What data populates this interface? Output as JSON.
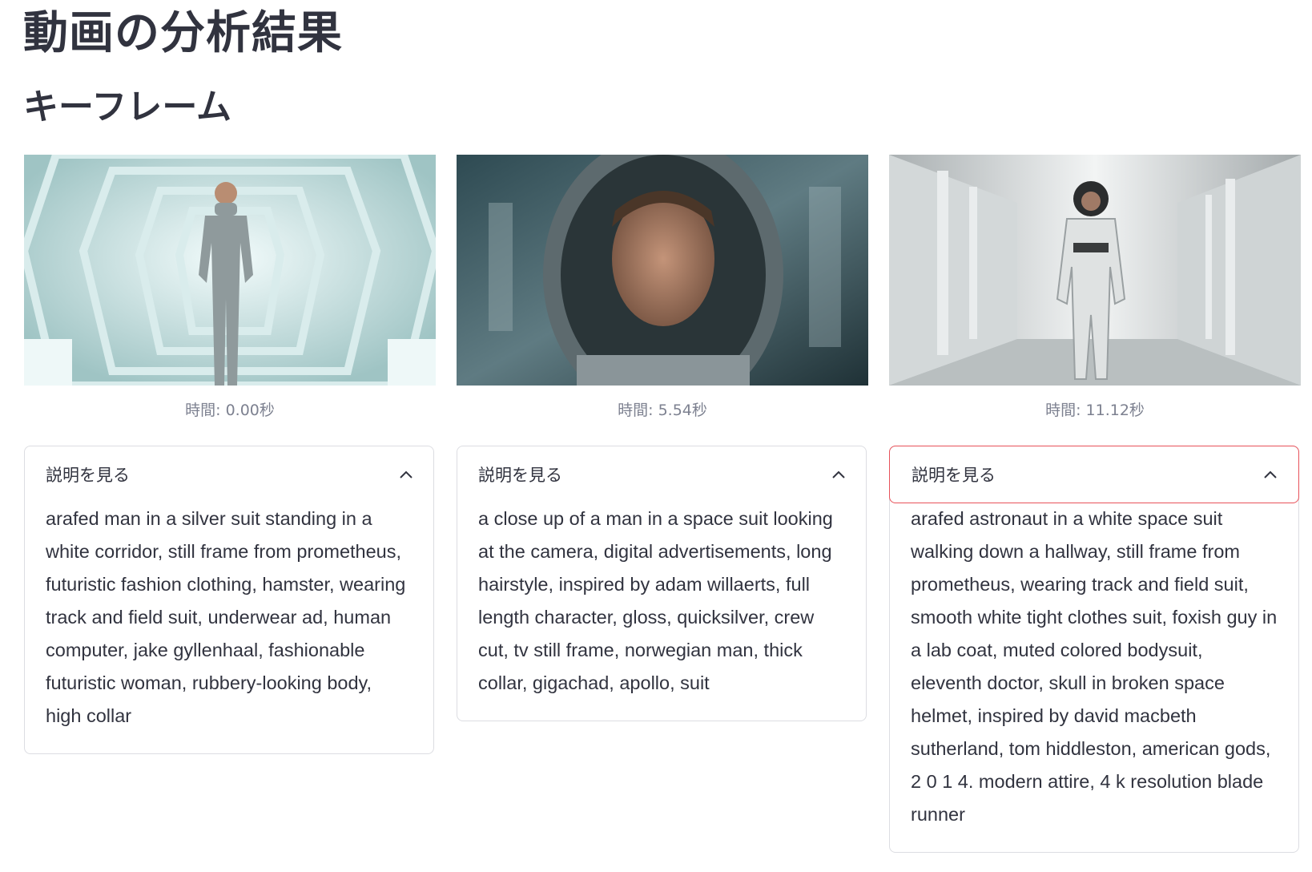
{
  "page": {
    "title": "動画の分析結果",
    "section_title": "キーフレーム"
  },
  "keyframes": [
    {
      "caption": "時間: 0.00秒",
      "expander_label": "説明を見る",
      "description": "arafed man in a silver suit standing in a white corridor, still frame from prometheus, futuristic fashion clothing, hamster, wearing track and field suit, underwear ad, human computer, jake gyllenhaal, fashionable futuristic woman, rubbery-looking body, high collar"
    },
    {
      "caption": "時間: 5.54秒",
      "expander_label": "説明を見る",
      "description": "a close up of a man in a space suit looking at the camera, digital advertisements, long hairstyle, inspired by adam willaerts, full length character, gloss, quicksilver, crew cut, tv still frame, norwegian man, thick collar, gigachad, apollo, suit"
    },
    {
      "caption": "時間: 11.12秒",
      "expander_label": "説明を見る",
      "description": "arafed astronaut in a white space suit walking down a hallway, still frame from prometheus, wearing track and field suit, smooth white tight clothes suit, foxish guy in a lab coat, muted colored bodysuit, eleventh doctor, skull in broken space helmet, inspired by david macbeth sutherland, tom hiddleston, american gods, 2 0 1 4. modern attire, 4 k resolution blade runner"
    }
  ],
  "icons": {
    "expander_toggle": "chevron-up-icon"
  },
  "colors": {
    "text": "#31333f",
    "caption": "#7d8190",
    "border": "#dcdde2",
    "focus_border": "#e8525a"
  }
}
